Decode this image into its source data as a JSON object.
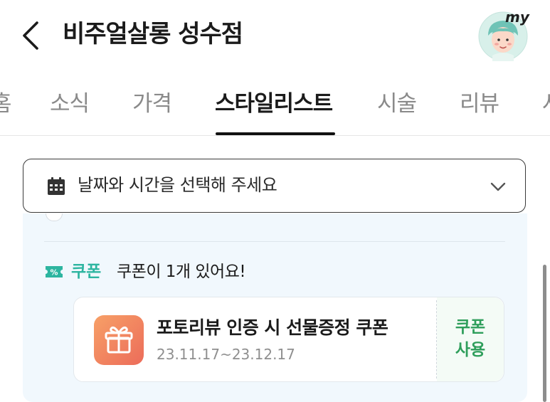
{
  "header": {
    "title": "비주얼살롱 성수점",
    "avatar_badge": "my"
  },
  "tabs": [
    {
      "label": "홈",
      "active": false
    },
    {
      "label": "소식",
      "active": false
    },
    {
      "label": "가격",
      "active": false
    },
    {
      "label": "스타일리스트",
      "active": true
    },
    {
      "label": "시술",
      "active": false
    },
    {
      "label": "리뷰",
      "active": false
    },
    {
      "label": "사",
      "active": false
    }
  ],
  "datepicker": {
    "placeholder": "날짜와 시간을 선택해 주세요",
    "icon": "calendar-icon"
  },
  "coupon_section": {
    "label": "쿠폰",
    "count_text": "쿠폰이 1개 있어요!",
    "coupon": {
      "name": "포토리뷰 인증 시 선물증정 쿠폰",
      "period": "23.11.17~23.12.17",
      "use_label_line1": "쿠폰",
      "use_label_line2": "사용"
    }
  },
  "colors": {
    "accent_teal": "#2db5a0",
    "accent_green": "#2e9e5b",
    "panel_bg": "#f1f8fd",
    "gift_gradient_start": "#f7a067",
    "gift_gradient_end": "#ec6c5a"
  }
}
